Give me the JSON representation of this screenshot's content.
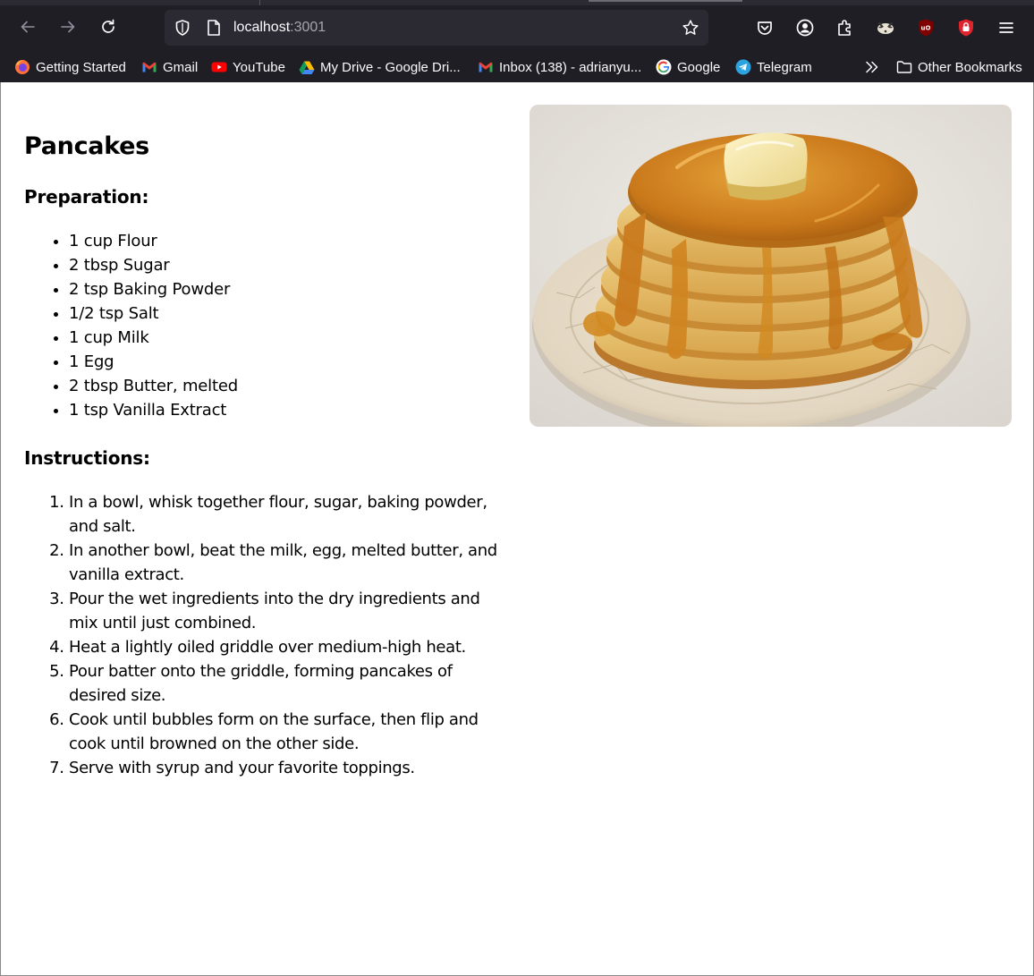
{
  "browser": {
    "url_host": "localhost",
    "url_port": ":3001",
    "bookmarks": [
      {
        "label": "Getting Started",
        "icon": "firefox-icon"
      },
      {
        "label": "Gmail",
        "icon": "gmail-icon"
      },
      {
        "label": "YouTube",
        "icon": "youtube-icon"
      },
      {
        "label": "My Drive - Google Dri...",
        "icon": "google-drive-icon"
      },
      {
        "label": "Inbox (138) - adrianyu...",
        "icon": "gmail-icon"
      },
      {
        "label": "Google",
        "icon": "google-icon"
      },
      {
        "label": "Telegram",
        "icon": "telegram-icon"
      }
    ],
    "other_bookmarks": "Other Bookmarks",
    "colors": {
      "chrome_bg": "#1f1e25",
      "urlbar_bg": "#2b2a33",
      "text": "#fbfbfe"
    }
  },
  "recipe": {
    "title": "Pancakes",
    "preparation_heading": "Preparation:",
    "ingredients": [
      "1 cup Flour",
      "2 tbsp Sugar",
      "2 tsp Baking Powder",
      "1/2 tsp Salt",
      "1 cup Milk",
      "1 Egg",
      "2 tbsp Butter, melted",
      "1 tsp Vanilla Extract"
    ],
    "instructions_heading": "Instructions:",
    "instructions": [
      "In a bowl, whisk together flour, sugar, baking powder, and salt.",
      "In another bowl, beat the milk, egg, melted butter, and vanilla extract.",
      "Pour the wet ingredients into the dry ingredients and mix until just combined.",
      "Heat a lightly oiled griddle over medium-high heat.",
      "Pour batter onto the griddle, forming pancakes of desired size.",
      "Cook until bubbles form on the surface, then flip and cook until browned on the other side.",
      "Serve with syrup and your favorite toppings."
    ]
  }
}
